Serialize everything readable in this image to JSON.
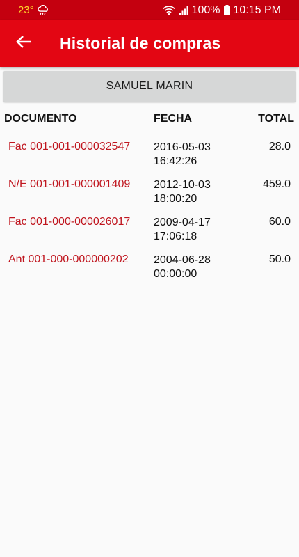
{
  "status_bar": {
    "temperature": "23°",
    "weather_icon": "rain-cloud-icon",
    "battery": "100%",
    "time": "10:15 PM"
  },
  "app_bar": {
    "back_icon": "arrow-left-icon",
    "title": "Historial de compras"
  },
  "customer": {
    "name": "SAMUEL MARIN"
  },
  "table": {
    "headers": {
      "documento": "DOCUMENTO",
      "fecha": "FECHA",
      "total": "TOTAL"
    },
    "rows": [
      {
        "documento": "Fac 001-001-000032547",
        "fecha": "2016-05-03 16:42:26",
        "total": "28.0"
      },
      {
        "documento": "N/E 001-001-000001409",
        "fecha": "2012-10-03 18:00:20",
        "total": "459.0"
      },
      {
        "documento": "Fac 001-000-000026017",
        "fecha": "2009-04-17 17:06:18",
        "total": "60.0"
      },
      {
        "documento": "Ant 001-000-000000202",
        "fecha": "2004-06-28 00:00:00",
        "total": "50.0"
      }
    ]
  },
  "colors": {
    "status_bar": "#c4000f",
    "app_bar": "#e30613",
    "document_text": "#c0161f",
    "background": "#fafafa",
    "button": "#d6d7d7"
  }
}
